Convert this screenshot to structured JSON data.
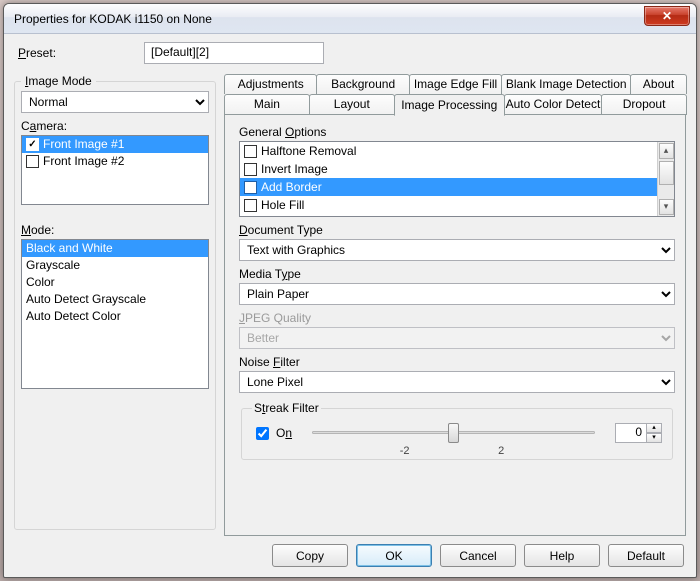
{
  "window": {
    "title": "Properties for KODAK i1150 on None"
  },
  "preset": {
    "label": "Preset:",
    "value": "[Default][2]"
  },
  "left": {
    "group_label": "Image Mode",
    "image_mode": {
      "value": "Normal"
    },
    "camera_label": "Camera:",
    "camera_items": [
      {
        "label": "Front Image #1",
        "checked": true,
        "selected": true
      },
      {
        "label": "Front Image #2",
        "checked": false,
        "selected": false
      }
    ],
    "mode_label": "Mode:",
    "mode_items": [
      "Black and White",
      "Grayscale",
      "Color",
      "Auto Detect Grayscale",
      "Auto Detect Color"
    ],
    "mode_selected": 0
  },
  "tabs": {
    "row1": [
      "Adjustments",
      "Background",
      "Image Edge Fill",
      "Blank Image Detection",
      "About"
    ],
    "row2": [
      "Main",
      "Layout",
      "Image Processing",
      "Auto Color Detect",
      "Dropout"
    ],
    "active": "Image Processing"
  },
  "panel": {
    "general_label": "General Options",
    "general_items": [
      {
        "label": "Halftone Removal",
        "checked": false,
        "selected": false
      },
      {
        "label": "Invert Image",
        "checked": false,
        "selected": false
      },
      {
        "label": "Add Border",
        "checked": false,
        "selected": true
      },
      {
        "label": "Hole Fill",
        "checked": false,
        "selected": false
      }
    ],
    "doc_type_label": "Document Type",
    "doc_type_value": "Text with Graphics",
    "media_type_label": "Media Type",
    "media_type_value": "Plain Paper",
    "jpeg_label": "JPEG Quality",
    "jpeg_value": "Better",
    "noise_label": "Noise Filter",
    "noise_value": "Lone Pixel",
    "streak_label": "Streak Filter",
    "streak_on_label": "On",
    "streak_on_checked": true,
    "streak_value": "0",
    "streak_tick_lo": "-2",
    "streak_tick_hi": "2"
  },
  "buttons": {
    "copy": "Copy",
    "ok": "OK",
    "cancel": "Cancel",
    "help": "Help",
    "default": "Default"
  }
}
